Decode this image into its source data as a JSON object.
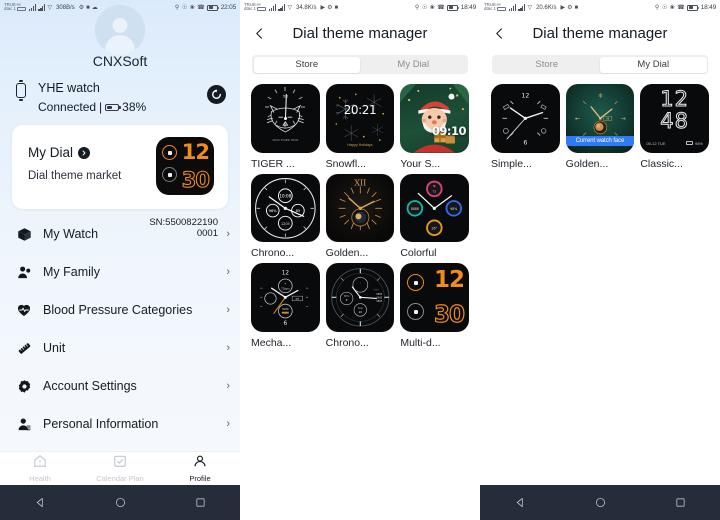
{
  "panels": {
    "profile": {
      "status": {
        "carrier_line1": "TRUE-H",
        "carrier_line2": "dtac 1",
        "net_speed": "308B/s",
        "time": "22:05"
      },
      "username": "CNXSoft",
      "device": {
        "name": "YHE watch",
        "status_text": "Connected",
        "battery": "38%"
      },
      "sync_icon": "sync-icon",
      "dial_card": {
        "title": "My Dial",
        "subtitle": "Dial theme market",
        "preview_hour": "12",
        "preview_minute": "30"
      },
      "menu": [
        {
          "label": "My Watch",
          "icon": "box-icon",
          "sub": "SN:5500822190 0001",
          "chevron": "›"
        },
        {
          "label": "My Family",
          "icon": "family-icon",
          "sub": "",
          "chevron": "›"
        },
        {
          "label": "Blood Pressure Categories",
          "icon": "heart-icon",
          "sub": "",
          "chevron": "›"
        },
        {
          "label": "Unit",
          "icon": "ruler-icon",
          "sub": "",
          "chevron": "›"
        },
        {
          "label": "Account Settings",
          "icon": "gear-icon",
          "sub": "",
          "chevron": "›"
        },
        {
          "label": "Personal Information",
          "icon": "person-icon",
          "sub": "",
          "chevron": "›"
        }
      ],
      "tabs": [
        {
          "label": "Health",
          "icon": "home-icon",
          "active": false
        },
        {
          "label": "Calendar Plan",
          "icon": "calendar-check-icon",
          "active": false
        },
        {
          "label": "Profile",
          "icon": "person-circle-icon",
          "active": true
        }
      ]
    },
    "store": {
      "status": {
        "carrier_line1": "TRUE-H",
        "carrier_line2": "dtac 1",
        "net_speed": "34.8K/s",
        "time": "18:49"
      },
      "title": "Dial theme manager",
      "back_icon": "back-chevron-icon",
      "segments": [
        {
          "label": "Store",
          "active": true
        },
        {
          "label": "My Dial",
          "active": false
        }
      ],
      "dials": [
        {
          "name": "TIGER ...",
          "art": "tiger"
        },
        {
          "name": "Snowfl...",
          "art": "snowflake",
          "time_label": "20:21",
          "caption": "Happy Holidays"
        },
        {
          "name": "Your S...",
          "art": "santa",
          "time_label": "09:10"
        },
        {
          "name": "Chrono...",
          "art": "chrono-white"
        },
        {
          "name": "Golden...",
          "art": "golden-xii",
          "roman": "XII"
        },
        {
          "name": "Colorful",
          "art": "colorful-rings"
        },
        {
          "name": "Mecha...",
          "art": "mechanical"
        },
        {
          "name": "Chrono...",
          "art": "chrono-dark"
        },
        {
          "name": "Multi-d...",
          "art": "multi-digit",
          "hour": "12",
          "minute": "30"
        }
      ]
    },
    "mydial": {
      "status": {
        "carrier_line1": "TRUE-H",
        "carrier_line2": "dtac 1",
        "net_speed": "20.6K/s",
        "time": "18:49"
      },
      "title": "Dial theme manager",
      "back_icon": "back-chevron-icon",
      "segments": [
        {
          "label": "Store",
          "active": false
        },
        {
          "label": "My Dial",
          "active": true
        }
      ],
      "dials": [
        {
          "name": "Simple...",
          "art": "simple-analog"
        },
        {
          "name": "Golden...",
          "art": "golden-green",
          "badge": "Current watch face"
        },
        {
          "name": "Classic...",
          "art": "classic-digits",
          "hour": "12",
          "minute": "48",
          "meta": "05-12 TUE",
          "batt": "98%"
        }
      ]
    }
  },
  "navbar": {
    "back": "nav-back-icon",
    "home": "nav-home-icon",
    "recents": "nav-recents-icon"
  },
  "colors": {
    "accent_orange": "#f08b1d",
    "badge_blue": "#2f7bf6",
    "navbar": "#262d3a",
    "profile_bg": "#dbeafb"
  }
}
